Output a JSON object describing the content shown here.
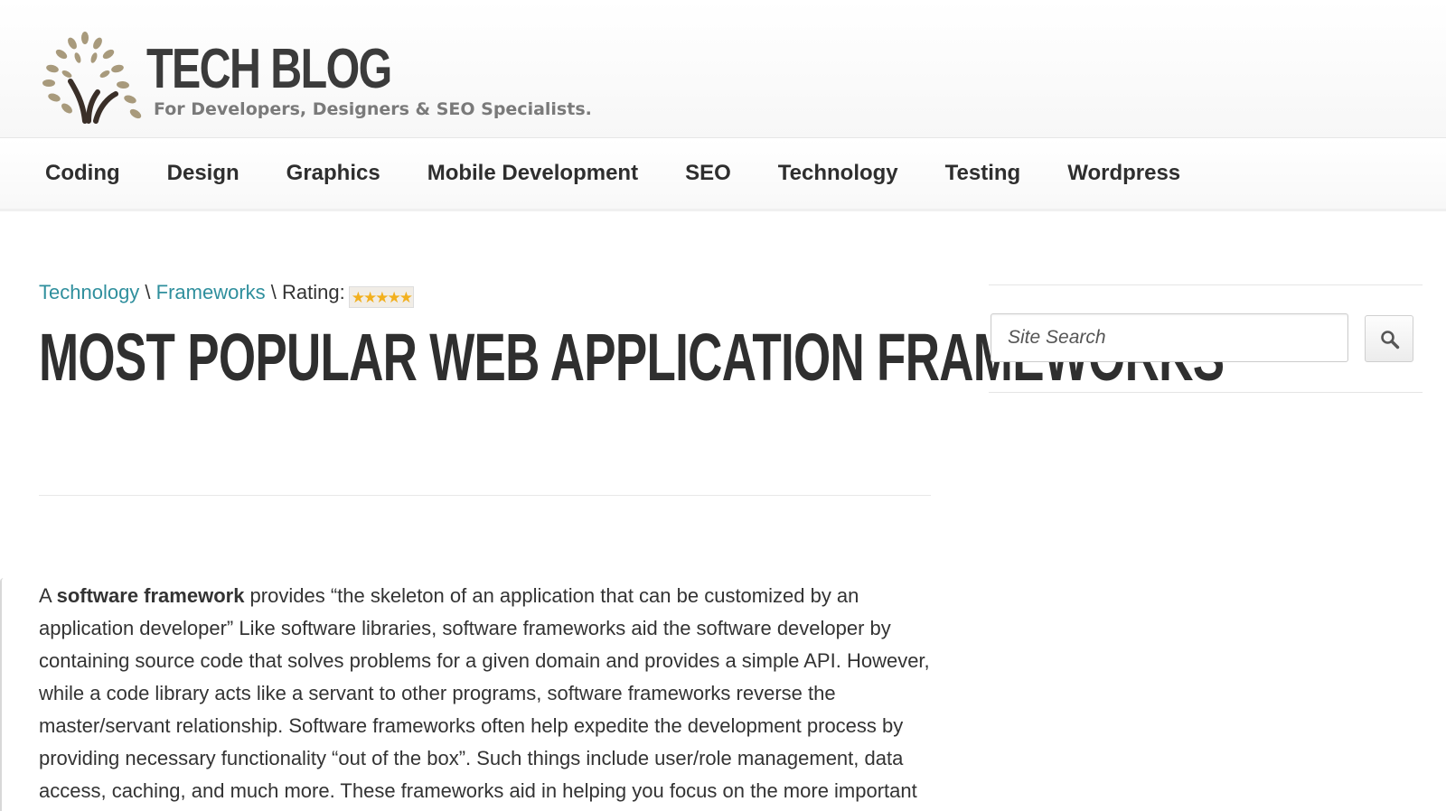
{
  "header": {
    "logo_title": "TECH BLOG",
    "tagline": "For Developers, Designers & SEO Specialists."
  },
  "nav": {
    "items": [
      {
        "label": "Coding"
      },
      {
        "label": "Design"
      },
      {
        "label": "Graphics"
      },
      {
        "label": "Mobile Development"
      },
      {
        "label": "SEO"
      },
      {
        "label": "Technology"
      },
      {
        "label": "Testing"
      },
      {
        "label": "Wordpress"
      }
    ]
  },
  "breadcrumb": {
    "category": "Technology",
    "sep1": " \\ ",
    "subcategory": "Frameworks",
    "sep2": " \\ ",
    "rating_label": "Rating:",
    "rating_value": 5,
    "rating_max": 5
  },
  "article": {
    "title": "MOST POPULAR WEB APPLICATION FRAMEWORKS",
    "intro_prefix": "A ",
    "intro_bold": "software framework",
    "intro_rest": " provides “the skeleton of an application that can be customized by an application developer” Like software libraries, software frameworks aid the software developer by containing source code that solves problems for a given domain and provides a simple API. However, while a code library acts like a servant to other programs, software frameworks reverse the master/servant relationship. Software frameworks often help expedite the development process by providing necessary functionality “out of the box”. Such things include user/role management, data access, caching, and much more. These frameworks aid in helping you focus on the more important"
  },
  "sidebar": {
    "search_placeholder": "Site Search"
  },
  "colors": {
    "link": "#2f8f9d",
    "text": "#333333",
    "title": "#2f2f2f",
    "star": "#f2b01e"
  },
  "icons": {
    "logo": "tree-logo-icon",
    "search": "search-icon",
    "star": "star-icon"
  }
}
